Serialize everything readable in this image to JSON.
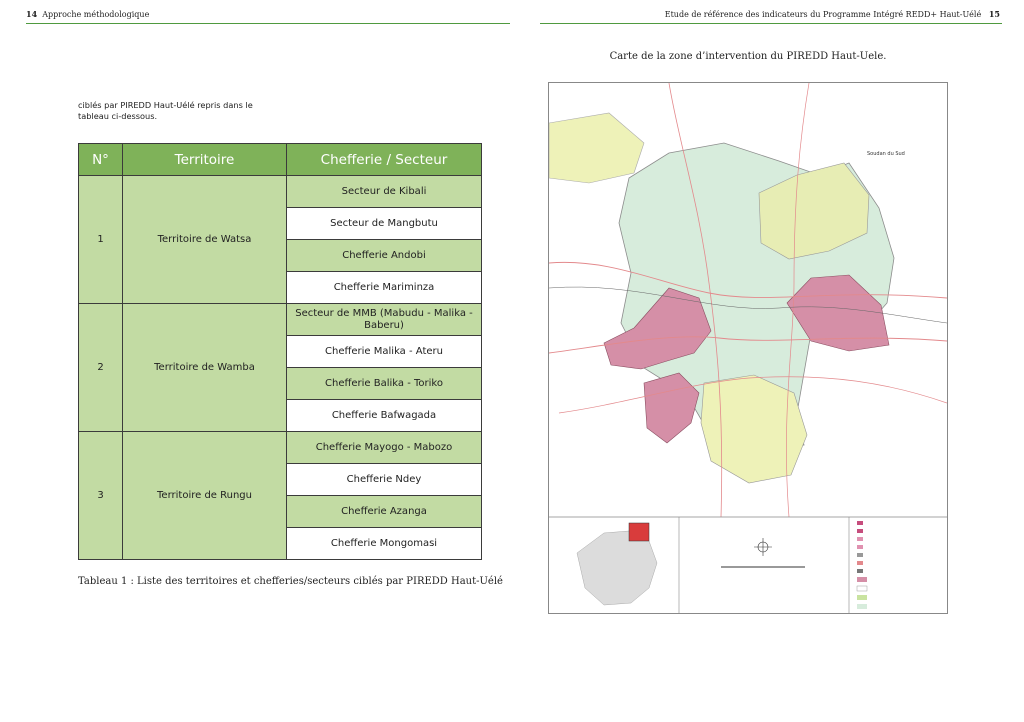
{
  "header": {
    "left_page_number": "14",
    "left_title": "Approche méthodologique",
    "right_title": "Etude de référence des indicateurs du Programme Intégré REDD+ Haut-Uélé",
    "right_page_number": "15"
  },
  "intro_text": "ciblés par  PIREDD Haut-Uélé repris dans le tableau ci-dessous.",
  "table": {
    "headers": [
      "N°",
      "Territoire",
      "Chefferie / Secteur"
    ],
    "groups": [
      {
        "num": "1",
        "territoire": "Territoire de Watsa",
        "sectors": [
          "Secteur de Kibali",
          "Secteur de Mangbutu",
          "Chefferie Andobi",
          "Chefferie Mariminza"
        ]
      },
      {
        "num": "2",
        "territoire": "Territoire de Wamba",
        "sectors": [
          "Secteur de MMB (Mabudu - Malika - Baberu)",
          "Chefferie Malika - Ateru",
          "Chefferie Balika - Toriko",
          "Chefferie Bafwagada"
        ]
      },
      {
        "num": "3",
        "territoire": "Territoire de Rungu",
        "sectors": [
          "Chefferie Mayogo - Mabozo",
          "Chefferie Ndey",
          "Chefferie Azanga",
          "Chefferie Mongomasi"
        ]
      }
    ]
  },
  "caption": "Tableau 1 : Liste des territoires et chefferies/secteurs ciblés par PIREDD Haut-Uélé",
  "map": {
    "title": "Carte de la zone d’intervention du PIREDD Haut-Uele.",
    "country_label": "Soudan du Sud",
    "colors": {
      "territory_fill": "#d7ecdc",
      "target_fill": "#d58fa7",
      "protected_fill": "#eef2b8",
      "roads": "#e3898c",
      "frame": "#888888"
    }
  },
  "colors": {
    "header_rule": "#4f9a3f",
    "table_header": "#7fb259",
    "table_band": "#c2dba3"
  }
}
